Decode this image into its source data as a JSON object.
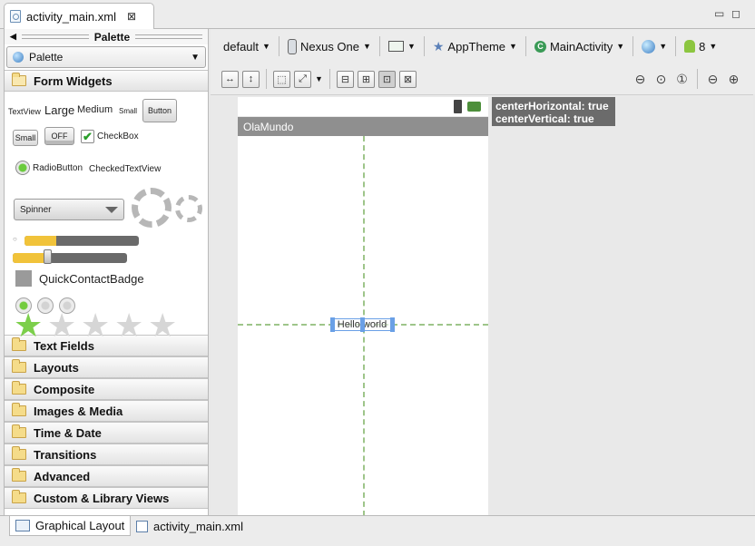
{
  "editor_tab": {
    "title": "activity_main.xml",
    "close_glyph": "⊠"
  },
  "palette": {
    "header": "Palette",
    "selector": "Palette",
    "open_category": "Form Widgets",
    "widgets": {
      "textview": "TextView",
      "large": "Large",
      "medium": "Medium",
      "small": "Small",
      "button": "Button",
      "small_button": "Small",
      "toggle_off": "OFF",
      "checkbox": "CheckBox",
      "radiobutton": "RadioButton",
      "checkedtextview": "CheckedTextView",
      "spinner": "Spinner",
      "quickcontactbadge": "QuickContactBadge",
      "progress_level": 0.28,
      "seek_level": 0.3,
      "rating_stars": 5,
      "rating_value": 1
    },
    "categories": [
      "Text Fields",
      "Layouts",
      "Composite",
      "Images & Media",
      "Time & Date",
      "Transitions",
      "Advanced",
      "Custom & Library Views"
    ]
  },
  "toolbar": {
    "config": "default",
    "device": "Nexus One",
    "theme": "AppTheme",
    "activity": "MainActivity",
    "api": "8"
  },
  "canvas": {
    "app_title": "OlaMundo",
    "textview": "Hello world",
    "hint_line1": "centerHorizontal: true",
    "hint_line2": "centerVertical: true"
  },
  "bottom_tabs": [
    "Graphical Layout",
    "activity_main.xml"
  ],
  "colors": {
    "accent": "#6aa0e6",
    "guide": "#9ec58a",
    "progress": "#f1c33a"
  }
}
